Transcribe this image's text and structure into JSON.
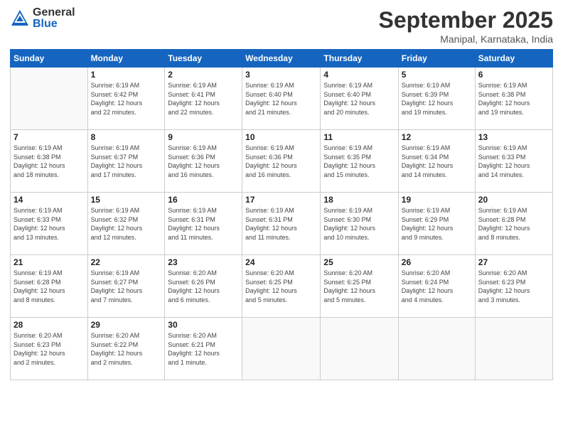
{
  "header": {
    "logo_general": "General",
    "logo_blue": "Blue",
    "month": "September 2025",
    "location": "Manipal, Karnataka, India"
  },
  "weekdays": [
    "Sunday",
    "Monday",
    "Tuesday",
    "Wednesday",
    "Thursday",
    "Friday",
    "Saturday"
  ],
  "weeks": [
    [
      {
        "day": "",
        "info": ""
      },
      {
        "day": "1",
        "info": "Sunrise: 6:19 AM\nSunset: 6:42 PM\nDaylight: 12 hours\nand 22 minutes."
      },
      {
        "day": "2",
        "info": "Sunrise: 6:19 AM\nSunset: 6:41 PM\nDaylight: 12 hours\nand 22 minutes."
      },
      {
        "day": "3",
        "info": "Sunrise: 6:19 AM\nSunset: 6:40 PM\nDaylight: 12 hours\nand 21 minutes."
      },
      {
        "day": "4",
        "info": "Sunrise: 6:19 AM\nSunset: 6:40 PM\nDaylight: 12 hours\nand 20 minutes."
      },
      {
        "day": "5",
        "info": "Sunrise: 6:19 AM\nSunset: 6:39 PM\nDaylight: 12 hours\nand 19 minutes."
      },
      {
        "day": "6",
        "info": "Sunrise: 6:19 AM\nSunset: 6:38 PM\nDaylight: 12 hours\nand 19 minutes."
      }
    ],
    [
      {
        "day": "7",
        "info": "Sunrise: 6:19 AM\nSunset: 6:38 PM\nDaylight: 12 hours\nand 18 minutes."
      },
      {
        "day": "8",
        "info": "Sunrise: 6:19 AM\nSunset: 6:37 PM\nDaylight: 12 hours\nand 17 minutes."
      },
      {
        "day": "9",
        "info": "Sunrise: 6:19 AM\nSunset: 6:36 PM\nDaylight: 12 hours\nand 16 minutes."
      },
      {
        "day": "10",
        "info": "Sunrise: 6:19 AM\nSunset: 6:36 PM\nDaylight: 12 hours\nand 16 minutes."
      },
      {
        "day": "11",
        "info": "Sunrise: 6:19 AM\nSunset: 6:35 PM\nDaylight: 12 hours\nand 15 minutes."
      },
      {
        "day": "12",
        "info": "Sunrise: 6:19 AM\nSunset: 6:34 PM\nDaylight: 12 hours\nand 14 minutes."
      },
      {
        "day": "13",
        "info": "Sunrise: 6:19 AM\nSunset: 6:33 PM\nDaylight: 12 hours\nand 14 minutes."
      }
    ],
    [
      {
        "day": "14",
        "info": "Sunrise: 6:19 AM\nSunset: 6:33 PM\nDaylight: 12 hours\nand 13 minutes."
      },
      {
        "day": "15",
        "info": "Sunrise: 6:19 AM\nSunset: 6:32 PM\nDaylight: 12 hours\nand 12 minutes."
      },
      {
        "day": "16",
        "info": "Sunrise: 6:19 AM\nSunset: 6:31 PM\nDaylight: 12 hours\nand 11 minutes."
      },
      {
        "day": "17",
        "info": "Sunrise: 6:19 AM\nSunset: 6:31 PM\nDaylight: 12 hours\nand 11 minutes."
      },
      {
        "day": "18",
        "info": "Sunrise: 6:19 AM\nSunset: 6:30 PM\nDaylight: 12 hours\nand 10 minutes."
      },
      {
        "day": "19",
        "info": "Sunrise: 6:19 AM\nSunset: 6:29 PM\nDaylight: 12 hours\nand 9 minutes."
      },
      {
        "day": "20",
        "info": "Sunrise: 6:19 AM\nSunset: 6:28 PM\nDaylight: 12 hours\nand 8 minutes."
      }
    ],
    [
      {
        "day": "21",
        "info": "Sunrise: 6:19 AM\nSunset: 6:28 PM\nDaylight: 12 hours\nand 8 minutes."
      },
      {
        "day": "22",
        "info": "Sunrise: 6:19 AM\nSunset: 6:27 PM\nDaylight: 12 hours\nand 7 minutes."
      },
      {
        "day": "23",
        "info": "Sunrise: 6:20 AM\nSunset: 6:26 PM\nDaylight: 12 hours\nand 6 minutes."
      },
      {
        "day": "24",
        "info": "Sunrise: 6:20 AM\nSunset: 6:25 PM\nDaylight: 12 hours\nand 5 minutes."
      },
      {
        "day": "25",
        "info": "Sunrise: 6:20 AM\nSunset: 6:25 PM\nDaylight: 12 hours\nand 5 minutes."
      },
      {
        "day": "26",
        "info": "Sunrise: 6:20 AM\nSunset: 6:24 PM\nDaylight: 12 hours\nand 4 minutes."
      },
      {
        "day": "27",
        "info": "Sunrise: 6:20 AM\nSunset: 6:23 PM\nDaylight: 12 hours\nand 3 minutes."
      }
    ],
    [
      {
        "day": "28",
        "info": "Sunrise: 6:20 AM\nSunset: 6:23 PM\nDaylight: 12 hours\nand 2 minutes."
      },
      {
        "day": "29",
        "info": "Sunrise: 6:20 AM\nSunset: 6:22 PM\nDaylight: 12 hours\nand 2 minutes."
      },
      {
        "day": "30",
        "info": "Sunrise: 6:20 AM\nSunset: 6:21 PM\nDaylight: 12 hours\nand 1 minute."
      },
      {
        "day": "",
        "info": ""
      },
      {
        "day": "",
        "info": ""
      },
      {
        "day": "",
        "info": ""
      },
      {
        "day": "",
        "info": ""
      }
    ]
  ]
}
